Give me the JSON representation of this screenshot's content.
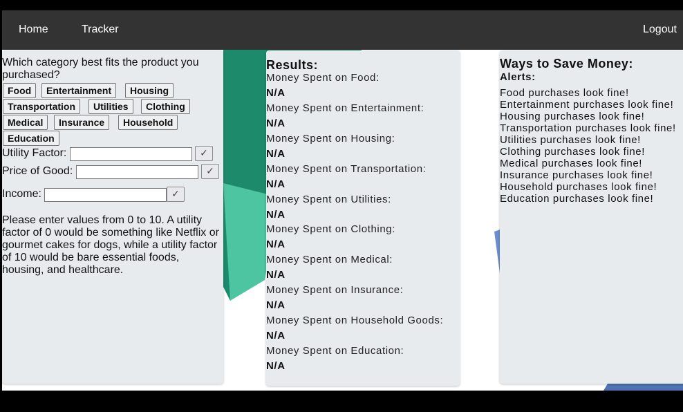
{
  "nav": {
    "home": "Home",
    "tracker": "Tracker",
    "logout": "Logout"
  },
  "input_panel": {
    "question": "Which category best fits the product you purchased?",
    "categories": [
      "Food",
      "Entertainment",
      "Housing",
      "Transportation",
      "Utilities",
      "Clothing",
      "Medical",
      "Insurance",
      "Household",
      "Education"
    ],
    "utility_label": "Utility Factor:",
    "price_label": "Price of Good:",
    "income_label": "Income:",
    "submit_symbol": "✓",
    "info": "Please enter values from 0 to 10. A utility factor of 0 would be something like Netflix or gourmet cakes for dogs, while a utility factor of 10 would be bare essential foods, housing, and healthcare."
  },
  "results_panel": {
    "title": "Results:",
    "items": [
      {
        "label": "Money Spent on Food:",
        "value": "N/A"
      },
      {
        "label": "Money Spent on Entertainment:",
        "value": "N/A"
      },
      {
        "label": "Money Spent on Housing:",
        "value": "N/A"
      },
      {
        "label": "Money Spent on Transportation:",
        "value": "N/A"
      },
      {
        "label": "Money Spent on Utilities:",
        "value": "N/A"
      },
      {
        "label": "Money Spent on Clothing:",
        "value": "N/A"
      },
      {
        "label": "Money Spent on Medical:",
        "value": "N/A"
      },
      {
        "label": "Money Spent on Insurance:",
        "value": "N/A"
      },
      {
        "label": "Money Spent on Household Goods:",
        "value": "N/A"
      },
      {
        "label": "Money Spent on Education:",
        "value": "N/A"
      }
    ]
  },
  "save_panel": {
    "title": "Ways to Save Money:",
    "alerts_title": "Alerts:",
    "alerts": [
      "Food purchases look fine!",
      "Entertainment purchases look fine!",
      "Housing purchases look fine!",
      "Transportation purchases look fine!",
      "Utilities purchases look fine!",
      "Clothing purchases look fine!",
      "Medical purchases look fine!",
      "Insurance purchases look fine!",
      "Household purchases look fine!",
      "Education purchases look fine!"
    ]
  },
  "colors": {
    "navbar": "#333333",
    "panel": "#e8ebee",
    "accent_green": "#1a8a6a",
    "accent_blue": "#5a7fc0"
  }
}
